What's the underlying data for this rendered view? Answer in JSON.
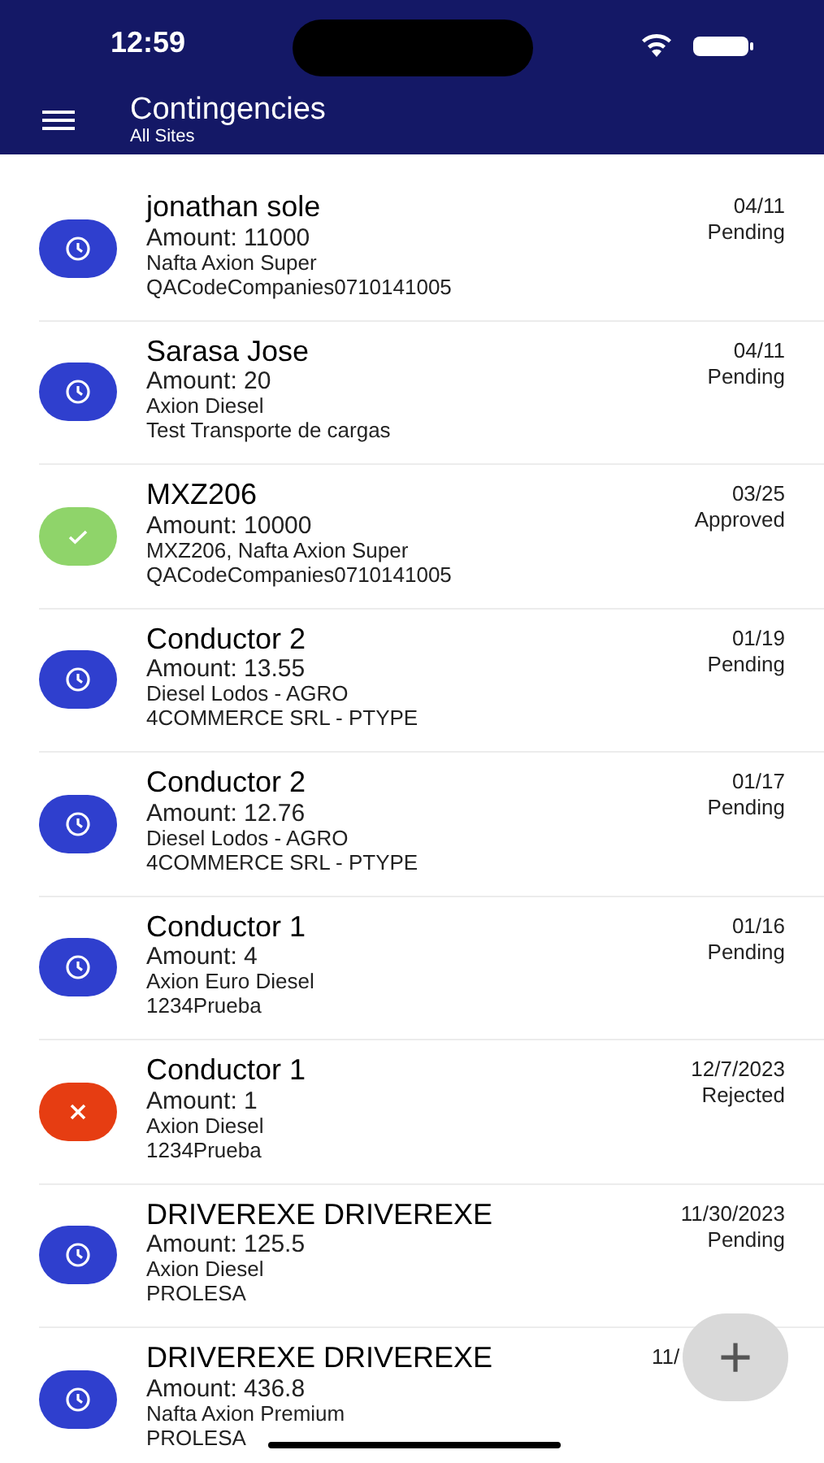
{
  "status_bar": {
    "time": "12:59"
  },
  "app_bar": {
    "title": "Contingencies",
    "subtitle": "All Sites"
  },
  "items": [
    {
      "kind": "pending",
      "name": "jonathan sole",
      "amount": "Amount: 11000",
      "product": "Nafta Axion Super",
      "company": "QACodeCompanies0710141005",
      "date": "04/11",
      "status": "Pending"
    },
    {
      "kind": "pending",
      "name": "Sarasa Jose",
      "amount": "Amount: 20",
      "product": "Axion Diesel",
      "company": "Test Transporte de cargas",
      "date": "04/11",
      "status": "Pending"
    },
    {
      "kind": "approved",
      "name": "MXZ206",
      "amount": "Amount: 10000",
      "product": "MXZ206, Nafta Axion Super",
      "company": "QACodeCompanies0710141005",
      "date": "03/25",
      "status": "Approved"
    },
    {
      "kind": "pending",
      "name": "Conductor 2",
      "amount": "Amount: 13.55",
      "product": "Diesel Lodos - AGRO",
      "company": "4COMMERCE SRL - PTYPE",
      "date": "01/19",
      "status": "Pending"
    },
    {
      "kind": "pending",
      "name": "Conductor 2",
      "amount": "Amount: 12.76",
      "product": "Diesel Lodos - AGRO",
      "company": "4COMMERCE SRL - PTYPE",
      "date": "01/17",
      "status": "Pending"
    },
    {
      "kind": "pending",
      "name": "Conductor 1",
      "amount": "Amount: 4",
      "product": "Axion Euro Diesel",
      "company": "1234Prueba",
      "date": "01/16",
      "status": "Pending"
    },
    {
      "kind": "rejected",
      "name": "Conductor 1",
      "amount": "Amount: 1",
      "product": "Axion Diesel",
      "company": "1234Prueba",
      "date": "12/7/2023",
      "status": "Rejected"
    },
    {
      "kind": "pending",
      "name": "DRIVEREXE DRIVEREXE",
      "amount": "Amount: 125.5",
      "product": "Axion Diesel",
      "company": "PROLESA",
      "date": "11/30/2023",
      "status": "Pending"
    },
    {
      "kind": "pending",
      "name": "DRIVEREXE DRIVEREXE",
      "amount": "Amount: 436.8",
      "product": "Nafta Axion Premium",
      "company": "PROLESA",
      "date": "11/"
    }
  ],
  "fab": {
    "label": "+"
  }
}
